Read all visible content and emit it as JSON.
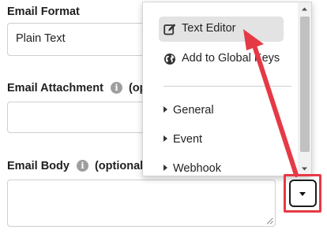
{
  "form": {
    "email_format": {
      "label": "Email Format",
      "value": "Plain Text"
    },
    "email_attachment": {
      "label": "Email Attachment",
      "suffix": "(op"
    },
    "email_body": {
      "label": "Email Body",
      "suffix": "(optional)"
    },
    "info_glyph": "i"
  },
  "menu": {
    "items": [
      {
        "label": "Text Editor",
        "icon": "edit-icon",
        "highlighted": true
      },
      {
        "label": "Add to Global Keys",
        "icon": "globe-icon",
        "highlighted": false
      }
    ],
    "sections": [
      "General",
      "Event",
      "Webhook"
    ]
  },
  "dropdown_button": {
    "icon": "caret-down-icon"
  },
  "annotation": {
    "color": "#e63946"
  }
}
